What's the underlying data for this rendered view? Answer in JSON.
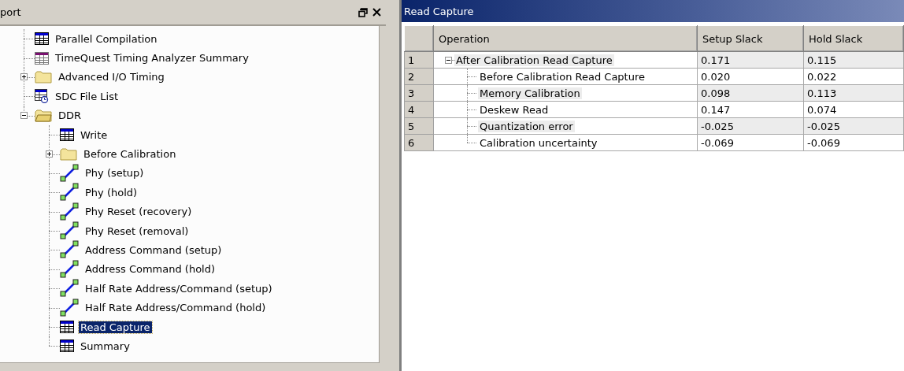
{
  "left_panel": {
    "title": "port",
    "tree": [
      {
        "label": "Parallel Compilation",
        "kind": "table",
        "selected": false
      },
      {
        "label": "TimeQuest Timing Analyzer Summary",
        "kind": "summary",
        "selected": false
      },
      {
        "label": "Advanced I/O Timing",
        "kind": "folder",
        "expanded": false,
        "selected": false
      },
      {
        "label": "SDC File List",
        "kind": "sdc",
        "selected": false
      },
      {
        "label": "DDR",
        "kind": "folder",
        "expanded": true,
        "selected": false,
        "children": [
          {
            "label": "Write",
            "kind": "table",
            "selected": false
          },
          {
            "label": "Before Calibration",
            "kind": "folder",
            "expanded": false,
            "selected": false
          },
          {
            "label": "Phy (setup)",
            "kind": "timing",
            "selected": false
          },
          {
            "label": "Phy (hold)",
            "kind": "timing",
            "selected": false
          },
          {
            "label": "Phy Reset (recovery)",
            "kind": "timing",
            "selected": false
          },
          {
            "label": "Phy Reset (removal)",
            "kind": "timing",
            "selected": false
          },
          {
            "label": "Address Command (setup)",
            "kind": "timing",
            "selected": false
          },
          {
            "label": "Address Command (hold)",
            "kind": "timing",
            "selected": false
          },
          {
            "label": "Half Rate Address/Command (setup)",
            "kind": "timing",
            "selected": false
          },
          {
            "label": "Half Rate Address/Command (hold)",
            "kind": "timing",
            "selected": false
          },
          {
            "label": "Read Capture",
            "kind": "table",
            "selected": true
          },
          {
            "label": "Summary",
            "kind": "table",
            "selected": false
          }
        ]
      }
    ]
  },
  "right_panel": {
    "title": "Read Capture",
    "table": {
      "columns": [
        "Operation",
        "Setup Slack",
        "Hold Slack"
      ],
      "rows": [
        {
          "index": "1",
          "operation": "After Calibration Read Capture",
          "setup_slack": "0.171",
          "hold_slack": "0.115",
          "expanded": true,
          "children": [
            {
              "index": "2",
              "operation": "Before Calibration Read Capture",
              "setup_slack": "0.020",
              "hold_slack": "0.022"
            },
            {
              "index": "3",
              "operation": "Memory Calibration",
              "setup_slack": "0.098",
              "hold_slack": "0.113"
            },
            {
              "index": "4",
              "operation": "Deskew Read",
              "setup_slack": "0.147",
              "hold_slack": "0.074"
            },
            {
              "index": "5",
              "operation": "Quantization error",
              "setup_slack": "-0.025",
              "hold_slack": "-0.025"
            },
            {
              "index": "6",
              "operation": "Calibration uncertainty",
              "setup_slack": "-0.069",
              "hold_slack": "-0.069"
            }
          ]
        }
      ]
    }
  }
}
